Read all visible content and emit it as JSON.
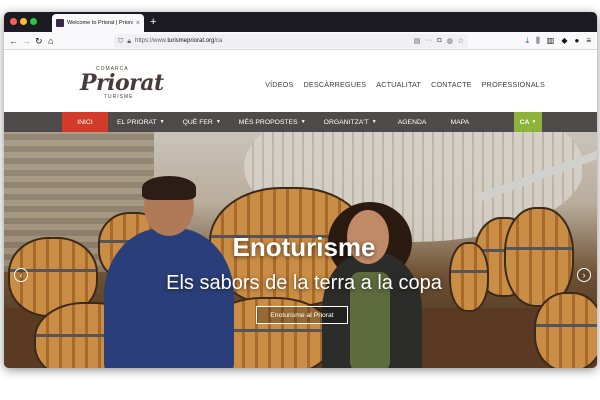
{
  "browser": {
    "tab_title": "Welcome to Priorat | Priorat",
    "tab_close": "×",
    "new_tab": "+",
    "url_prefix": "https://www.",
    "url_domain": "turismepriorat.org",
    "url_suffix": "/ca",
    "icons": [
      "back-icon",
      "forward-icon",
      "reload-icon",
      "home-icon",
      "shield-icon",
      "lock-icon",
      "reader-icon",
      "more-icon",
      "pocket-icon",
      "sync-icon",
      "star-icon",
      "download-icon",
      "library-icon",
      "sidebar-icon",
      "extension-icon",
      "account-icon",
      "menu-icon"
    ]
  },
  "logo": {
    "comarca": "COMARCA",
    "word": "Priorat",
    "turisme": "TURISME"
  },
  "top_links": [
    "VÍDEOS",
    "DESCÀRREGUES",
    "ACTUALITAT",
    "CONTACTE",
    "PROFESSIONALS"
  ],
  "menu": [
    {
      "label": "INICI",
      "dropdown": false,
      "active": true
    },
    {
      "label": "EL PRIORAT",
      "dropdown": true,
      "active": false
    },
    {
      "label": "QUÈ FER",
      "dropdown": true,
      "active": false
    },
    {
      "label": "MÉS PROPOSTES",
      "dropdown": true,
      "active": false
    },
    {
      "label": "ORGANITZA'T",
      "dropdown": true,
      "active": false
    },
    {
      "label": "AGENDA",
      "dropdown": false,
      "active": false
    },
    {
      "label": "MAPA",
      "dropdown": false,
      "active": false
    }
  ],
  "language": "CA",
  "hero": {
    "title": "Enoturisme",
    "subtitle": "Els sabors de la terra a la copa",
    "button": "Enoturisme al Priorat",
    "prev": "‹",
    "next": "›"
  },
  "colors": {
    "menu_bg": "#4e4b4a",
    "active": "#d23a2a",
    "lang": "#8db33a",
    "logo": "#4a3b3b"
  }
}
